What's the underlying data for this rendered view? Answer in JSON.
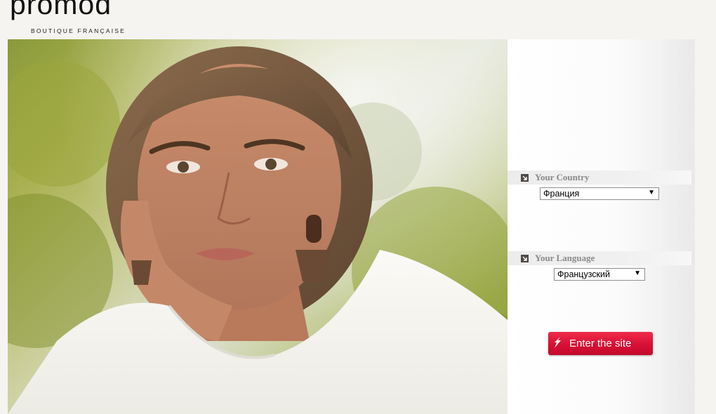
{
  "brand": {
    "logo_text": "promod",
    "tagline": "BOUTIQUE FRANÇAISE"
  },
  "hero": {
    "image": "woman-portrait-photo"
  },
  "country": {
    "label": "Your Country",
    "selected": "Франция",
    "icon": "arrow-square-icon"
  },
  "language": {
    "label": "Your Language",
    "selected": "Французский",
    "icon": "arrow-square-icon"
  },
  "enter_button": {
    "label": "Enter the site",
    "icon": "cursor-arrow-icon",
    "color": "#d90f34"
  },
  "colors": {
    "page_background": "#f5f4f1",
    "section_label": "#8a8a8a",
    "accent": "#d90f34"
  }
}
